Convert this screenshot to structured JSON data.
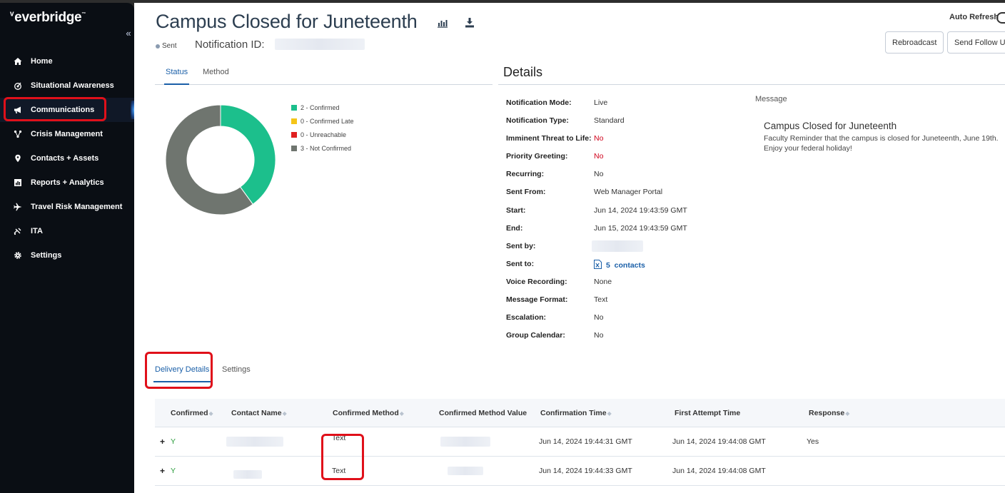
{
  "sidebar": {
    "logo": "everbridge",
    "collapse_icon": "«",
    "items": [
      {
        "label": "Home",
        "icon": "home-icon"
      },
      {
        "label": "Situational Awareness",
        "icon": "radar-icon"
      },
      {
        "label": "Communications",
        "icon": "megaphone-icon"
      },
      {
        "label": "Crisis Management",
        "icon": "network-icon"
      },
      {
        "label": "Contacts + Assets",
        "icon": "location-pin-icon"
      },
      {
        "label": "Reports + Analytics",
        "icon": "chart-icon"
      },
      {
        "label": "Travel Risk Management",
        "icon": "airplane-icon"
      },
      {
        "label": "ITA",
        "icon": "satellite-icon"
      },
      {
        "label": "Settings",
        "icon": "gear-icon"
      }
    ],
    "active_index": 2
  },
  "header": {
    "title": "Campus Closed for Juneteenth",
    "status": "Sent",
    "notification_id_label": "Notification ID:",
    "auto_refresh_label": "Auto Refresh",
    "rebroadcast_label": "Rebroadcast",
    "send_follow_up_label": "Send Follow Up"
  },
  "status_tabs": {
    "status": "Status",
    "method": "Method"
  },
  "chart_data": {
    "type": "pie",
    "donut": true,
    "categories": [
      "2 - Confirmed",
      "0 - Confirmed Late",
      "0 - Unreachable",
      "3 - Not Confirmed"
    ],
    "values": [
      2,
      0,
      0,
      3
    ],
    "colors": [
      "#1cbf8c",
      "#f5c518",
      "#e02020",
      "#6f756f"
    ],
    "legend_placement": "right"
  },
  "details": {
    "title": "Details",
    "rows": [
      {
        "key": "Notification Mode:",
        "value": "Live",
        "style": ""
      },
      {
        "key": "Notification Type:",
        "value": "Standard",
        "style": ""
      },
      {
        "key": "Imminent Threat to Life:",
        "value": "No",
        "style": "red"
      },
      {
        "key": "Priority Greeting:",
        "value": "No",
        "style": "red"
      },
      {
        "key": "Recurring:",
        "value": "No",
        "style": ""
      },
      {
        "key": "Sent From:",
        "value": "Web Manager Portal",
        "style": ""
      },
      {
        "key": "Start:",
        "value": "Jun 14, 2024 19:43:59 GMT",
        "style": ""
      },
      {
        "key": "End:",
        "value": "Jun 15, 2024 19:43:59 GMT",
        "style": ""
      },
      {
        "key": "Sent by:",
        "value": "",
        "style": "blur"
      },
      {
        "key": "Sent to:",
        "value": "5  contacts",
        "style": "link"
      },
      {
        "key": "Voice Recording:",
        "value": "None",
        "style": ""
      },
      {
        "key": "Message Format:",
        "value": "Text",
        "style": ""
      },
      {
        "key": "Escalation:",
        "value": "No",
        "style": ""
      },
      {
        "key": "Group Calendar:",
        "value": "No",
        "style": ""
      }
    ],
    "message_label": "Message",
    "message_title": "Campus Closed for Juneteenth",
    "message_body": "Faculty Reminder that the campus is closed for Juneteenth, June 19th. Enjoy your federal holiday!"
  },
  "bottom_tabs": {
    "delivery_details": "Delivery Details",
    "settings": "Settings"
  },
  "table": {
    "columns": [
      "Confirmed",
      "Contact Name",
      "Confirmed Method",
      "Confirmed Method Value",
      "Confirmation Time",
      "First Attempt Time",
      "Response"
    ],
    "rows": [
      {
        "expand": "+",
        "confirmed": "Y",
        "contact_name": "",
        "method": "Text",
        "method_value": "",
        "confirmation_time": "Jun 14, 2024 19:44:31 GMT",
        "first_attempt": "Jun 14, 2024 19:44:08 GMT",
        "response": "Yes"
      },
      {
        "expand": "+",
        "confirmed": "Y",
        "contact_name": "",
        "method": "Text",
        "method_value": "",
        "confirmation_time": "Jun 14, 2024 19:44:33 GMT",
        "first_attempt": "Jun 14, 2024 19:44:08 GMT",
        "response": ""
      }
    ]
  }
}
